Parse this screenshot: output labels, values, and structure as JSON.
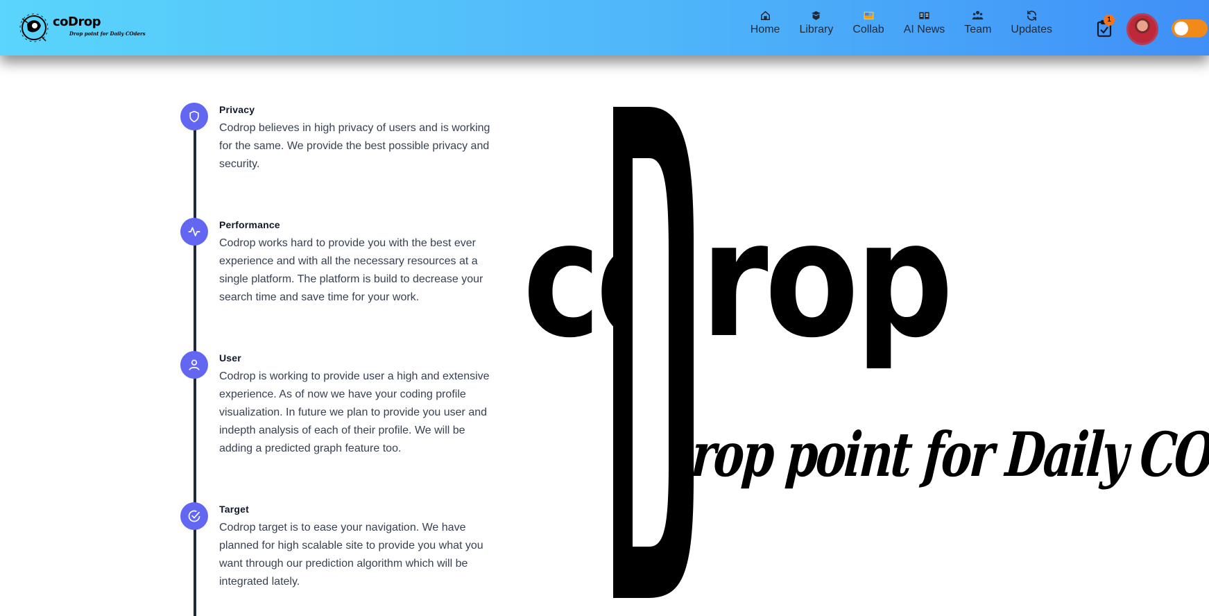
{
  "navbar": {
    "brand": {
      "word": "coDrop",
      "tagline": "Drop point for Daily COders"
    },
    "items": [
      {
        "label": "Home",
        "icon": "home-icon"
      },
      {
        "label": "Library",
        "icon": "book-icon"
      },
      {
        "label": "Collab",
        "icon": "collab-icon"
      },
      {
        "label": "AI News",
        "icon": "news-icon"
      },
      {
        "label": "Team",
        "icon": "team-icon"
      },
      {
        "label": "Updates",
        "icon": "refresh-icon"
      }
    ],
    "clipboard_badge": "1",
    "theme_toggle": {
      "state": "off",
      "color": "#f28a1a"
    }
  },
  "timeline": [
    {
      "title": "Privacy",
      "icon": "shield-icon",
      "desc": "Codrop believes in high privacy of users and is working for the same. We provide the best possible privacy and security."
    },
    {
      "title": "Performance",
      "icon": "activity-icon",
      "desc": "Codrop works hard to provide you with the best ever experience and with all the necessary resources at a single platform. The platform is build to decrease your search time and save time for your work."
    },
    {
      "title": "User",
      "icon": "user-icon",
      "desc": "Codrop is working to provide user a high and extensive experience. As of now we have your coding profile visualization. In future we plan to provide you user and indepth analysis of each of their profile. We will be adding a predicted graph feature too."
    },
    {
      "title": "Target",
      "icon": "check-circle-icon",
      "desc": "Codrop target is to ease your navigation. We have planned for high scalable site to provide you what you want through our prediction algorithm which will be integrated lately."
    }
  ],
  "big_logo": {
    "co": "co",
    "rop": "rop",
    "tagline": "rop point for Daily COders"
  },
  "colors": {
    "accent": "#6366f1",
    "nav_start": "#5ad5fb",
    "nav_end": "#3f8ff7"
  }
}
